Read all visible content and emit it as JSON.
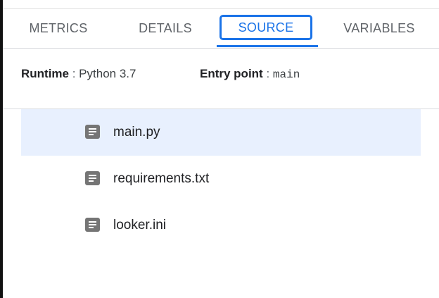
{
  "tabs": {
    "metrics": "METRICS",
    "details": "DETAILS",
    "source": "SOURCE",
    "variables": "VARIABLES",
    "active": "SOURCE"
  },
  "info": {
    "runtime_label": "Runtime",
    "runtime_sep": " : ",
    "runtime_value": "Python 3.7",
    "entry_label": "Entry point",
    "entry_sep": " : ",
    "entry_value": "main"
  },
  "files": [
    {
      "name": "main.py",
      "icon": "document-icon",
      "selected": true
    },
    {
      "name": "requirements.txt",
      "icon": "document-icon",
      "selected": false
    },
    {
      "name": "looker.ini",
      "icon": "document-icon",
      "selected": false
    }
  ],
  "colors": {
    "accent": "#1a73e8",
    "selected_row": "#e8f0fe",
    "tab_text": "#5f6368",
    "icon": "#757575"
  }
}
